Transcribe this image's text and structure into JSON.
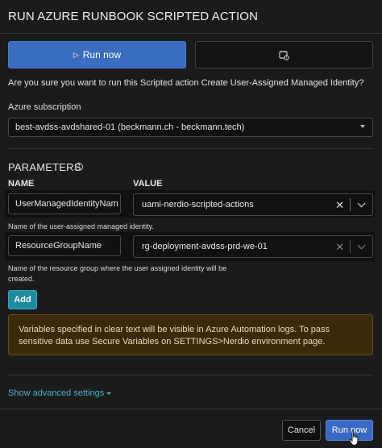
{
  "dialog": {
    "title": "RUN AZURE RUNBOOK SCRIPTED ACTION"
  },
  "tabs": {
    "run_now_label": "Run now",
    "schedule_icon": "calendar-clock-icon"
  },
  "confirm_text": "Are you sure you want to run this Scripted action Create User-Assigned Managed Identity?",
  "subscription": {
    "label": "Azure subscription",
    "value": "best-avdss-avdshared-01 (beckmann.ch - beckmann.tech)"
  },
  "parameters": {
    "title": "PARAMETERS",
    "name_header": "NAME",
    "value_header": "VALUE",
    "rows": [
      {
        "name": "UserManagedIdentityNam",
        "value": "uami-nerdio-scripted-actions",
        "description": "Name of the user-assigned managed identity."
      },
      {
        "name": "ResourceGroupName",
        "value": "rg-deployment-avdss-prd-we-01",
        "description": "Name of the resource group where the user assigned identity will be created."
      }
    ],
    "add_label": "Add"
  },
  "warning_text": "Variables specified in clear text will be visible in Azure Automation logs. To pass sensitive data use Secure Variables on SETTINGS>Nerdio environment page.",
  "advanced_label": "Show advanced settings",
  "footer": {
    "cancel_label": "Cancel",
    "run_label": "Run now"
  },
  "colors": {
    "primary": "#3b6dbf",
    "accent": "#1f8aa0",
    "warning_bg": "#3b2a0a",
    "link": "#4fb0c6"
  }
}
